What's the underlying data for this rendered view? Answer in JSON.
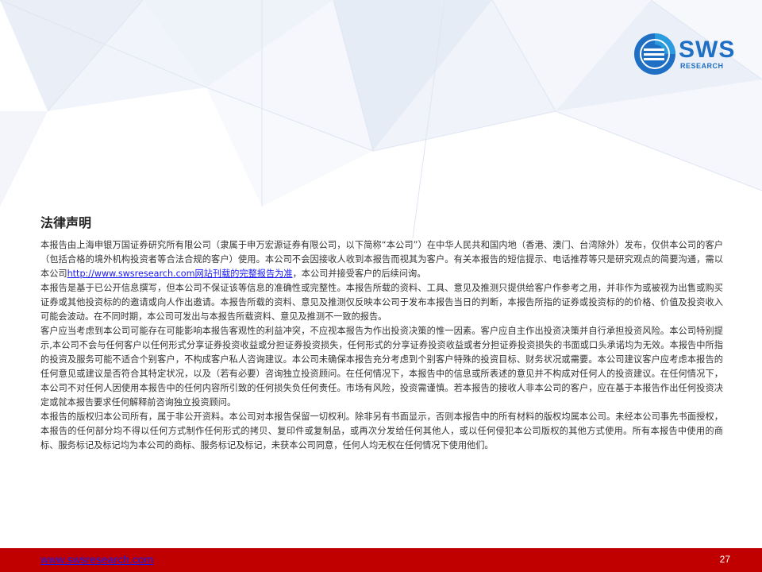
{
  "logo": {
    "text": "SWS",
    "subtext": "RESEARCH"
  },
  "document": {
    "title": "法律声明",
    "paragraphs": [
      {
        "pre": "本报告由上海申银万国证券研究所有限公司（隶属于申万宏源证券有限公司，以下简称“本公司”）在中华人民共和国内地（香港、澳门、台湾除外）发布，仅供本公司的客户（包括合格的境外机构投资者等合法合规的客户）使用。本公司不会因接收人收到本报告而视其为客户。有关本报告的短信提示、电话推荐等只是研究观点的简要沟通，需以本公司",
        "link": "http://www.swsresearch.com网站刊载的完整报告为准",
        "post": "，本公司并接受客户的后续问询。"
      },
      {
        "text": "本报告是基于已公开信息撰写，但本公司不保证该等信息的准确性或完整性。本报告所载的资料、工具、意见及推测只提供给客户作参考之用，并非作为或被视为出售或购买证券或其他投资标的的邀请或向人作出邀请。本报告所载的资料、意见及推测仅反映本公司于发布本报告当日的判断，本报告所指的证券或投资标的的价格、价值及投资收入可能会波动。在不同时期，本公司可发出与本报告所载资料、意见及推测不一致的报告。"
      },
      {
        "text": "客户应当考虑到本公司可能存在可能影响本报告客观性的利益冲突，不应视本报告为作出投资决策的惟一因素。客户应自主作出投资决策并自行承担投资风险。本公司特别提示,本公司不会与任何客户以任何形式分享证券投资收益或分担证券投资损失，任何形式的分享证券投资收益或者分担证券投资损失的书面或口头承诺均为无效。本报告中所指的投资及服务可能不适合个别客户，不构成客户私人咨询建议。本公司未确保本报告充分考虑到个别客户特殊的投资目标、财务状况或需要。本公司建议客户应考虑本报告的任何意见或建议是否符合其特定状况，以及（若有必要）咨询独立投资顾问。在任何情况下，本报告中的信息或所表述的意见并不构成对任何人的投资建议。在任何情况下，本公司不对任何人因使用本报告中的任何内容所引致的任何损失负任何责任。市场有风险，投资需谨慎。若本报告的接收人非本公司的客户，应在基于本报告作出任何投资决定或就本报告要求任何解释前咨询独立投资顾问。"
      },
      {
        "text": "本报告的版权归本公司所有，属于非公开资料。本公司对本报告保留一切权利。除非另有书面显示，否则本报告中的所有材料的版权均属本公司。未经本公司事先书面授权，本报告的任何部分均不得以任何方式制作任何形式的拷贝、复印件或复制品，或再次分发给任何其他人，或以任何侵犯本公司版权的其他方式使用。所有本报告中使用的商标、服务标记及标记均为本公司的商标、服务标记及标记，未获本公司同意，任何人均无权在任何情况下使用他们。"
      }
    ]
  },
  "footer": {
    "website": "www.swsresearch.com",
    "page_number": "27",
    "bar_color": "#c00000"
  }
}
